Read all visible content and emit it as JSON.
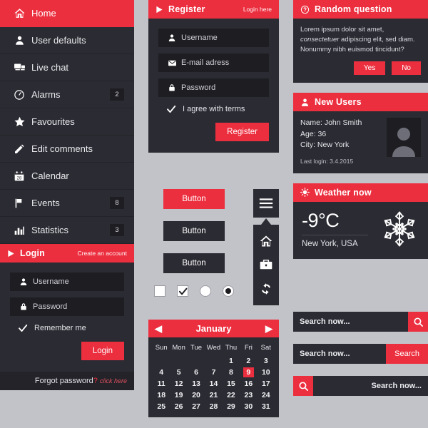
{
  "theme": {
    "accent": "#ec2f3f",
    "panel": "#2b2b33",
    "panel_dark": "#1d1d22",
    "page_bg": "#c2c3c8"
  },
  "sidebar": {
    "items": [
      {
        "label": "Home",
        "icon": "home-icon",
        "badge": "",
        "active": true
      },
      {
        "label": "User defaults",
        "icon": "user-icon",
        "badge": "",
        "active": false
      },
      {
        "label": "Live chat",
        "icon": "chat-icon",
        "badge": "",
        "active": false
      },
      {
        "label": "Alarms",
        "icon": "clock-icon",
        "badge": "2",
        "active": false
      },
      {
        "label": "Favourites",
        "icon": "star-icon",
        "badge": "",
        "active": false
      },
      {
        "label": "Edit comments",
        "icon": "pencil-icon",
        "badge": "",
        "active": false
      },
      {
        "label": "Calendar",
        "icon": "calendar-icon",
        "badge": "",
        "active": false
      },
      {
        "label": "Events",
        "icon": "flag-icon",
        "badge": "8",
        "active": false
      },
      {
        "label": "Statistics",
        "icon": "bars-icon",
        "badge": "3",
        "active": false
      }
    ]
  },
  "login": {
    "title": "Login",
    "link": "Create an account",
    "fields": [
      {
        "placeholder": "Username",
        "icon": "user-icon"
      },
      {
        "placeholder": "Password",
        "icon": "lock-icon"
      }
    ],
    "remember_label": "Remember me",
    "submit_label": "Login",
    "footer_text": "Forgot password",
    "footer_mark": "?",
    "footer_link": "click here"
  },
  "register": {
    "title": "Register",
    "link": "Login here",
    "fields": [
      {
        "placeholder": "Username",
        "icon": "user-icon"
      },
      {
        "placeholder": "E-mail adress",
        "icon": "mail-icon"
      },
      {
        "placeholder": "Password",
        "icon": "lock-icon"
      }
    ],
    "terms_label": "I agree with terms",
    "submit_label": "Register"
  },
  "buttons": {
    "primary_label": "Button",
    "secondary_label": "Button",
    "tertiary_label": "Button"
  },
  "icon_stack": {
    "menu": "hamburger-icon",
    "items": [
      "home-icon",
      "briefcase-icon",
      "refresh-icon"
    ]
  },
  "calendar": {
    "month": "January",
    "prev": "◀",
    "next": "▶",
    "dow": [
      "Sun",
      "Mon",
      "Tue",
      "Wed",
      "Thu",
      "Fri",
      "Sat"
    ],
    "lead_blanks": 4,
    "days": [
      1,
      2,
      3,
      4,
      5,
      6,
      7,
      8,
      9,
      10,
      11,
      12,
      13,
      14,
      15,
      16,
      17,
      18,
      19,
      20,
      21,
      22,
      23,
      24,
      25,
      26,
      27,
      28,
      29,
      30,
      31
    ],
    "today": 9
  },
  "question": {
    "title": "Random question",
    "icon": "question-mark-icon",
    "paragraph1_a": "Lorem ipsum dolor sit amet, ",
    "paragraph1_em": "consectetuer",
    "paragraph1_b": " adipiscing elit, sed diam.",
    "paragraph2": "Nonummy nibh euismod tincidunt?",
    "yes_label": "Yes",
    "no_label": "No"
  },
  "new_users": {
    "title": "New Users",
    "icon": "user-icon",
    "name_line": "Name: John Smith",
    "age_line": "Age: 36",
    "city_line": "City: New York",
    "last_login": "Last login: 3.4.2015"
  },
  "weather": {
    "title": "Weather now",
    "icon": "sun-icon",
    "temperature": "-9°C",
    "location": "New York, USA",
    "condition_icon": "snowflake-icon"
  },
  "searches": [
    {
      "placeholder": "Search now...",
      "button_label": "",
      "icon": "search-icon",
      "layout": "icon-right"
    },
    {
      "placeholder": "Search now...",
      "button_label": "Search",
      "icon": "",
      "layout": "text-right"
    },
    {
      "placeholder": "Search now...",
      "button_label": "",
      "icon": "search-icon",
      "layout": "icon-left"
    }
  ]
}
